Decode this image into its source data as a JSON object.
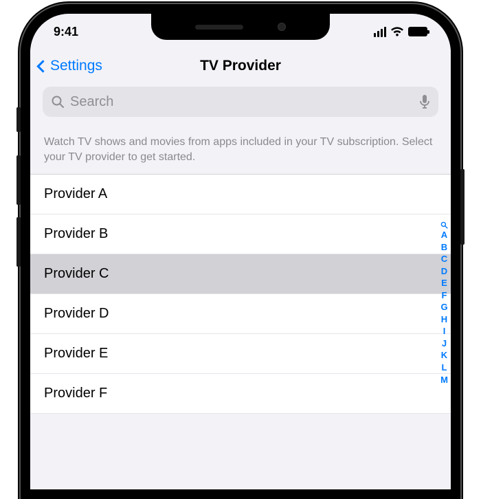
{
  "status": {
    "time": "9:41"
  },
  "nav": {
    "back_label": "Settings",
    "title": "TV Provider"
  },
  "search": {
    "placeholder": "Search"
  },
  "description": "Watch TV shows and movies from apps included in your TV subscription. Select your TV provider to get started.",
  "providers": [
    {
      "label": "Provider A",
      "selected": false
    },
    {
      "label": "Provider B",
      "selected": false
    },
    {
      "label": "Provider C",
      "selected": true
    },
    {
      "label": "Provider D",
      "selected": false
    },
    {
      "label": "Provider E",
      "selected": false
    },
    {
      "label": "Provider F",
      "selected": false
    }
  ],
  "index_letters": [
    "A",
    "B",
    "C",
    "D",
    "E",
    "F",
    "G",
    "H",
    "I",
    "J",
    "K",
    "L",
    "M"
  ]
}
